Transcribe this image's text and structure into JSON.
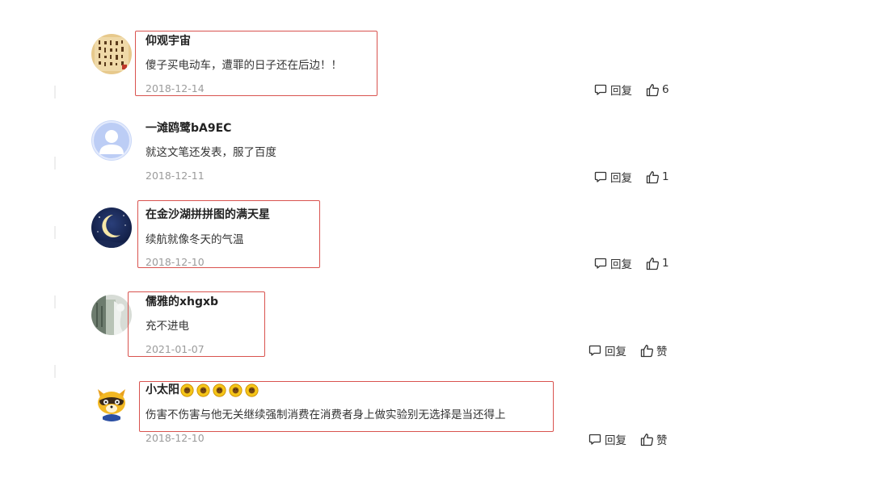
{
  "comments": [
    {
      "username": "仰观宇宙",
      "content": "傻子买电动车，遭罪的日子还在后边！！",
      "date": "2018-12-14",
      "reply_label": "回复",
      "like_label": "6",
      "avatar": "calligraphy-avatar"
    },
    {
      "username": "一滩鸥鹭bA9EC",
      "content": "就这文笔还发表，服了百度",
      "date": "2018-12-11",
      "reply_label": "回复",
      "like_label": "1",
      "avatar": "default-user-avatar"
    },
    {
      "username": "在金沙湖拼拼图的满天星",
      "content": "续航就像冬天的气温",
      "date": "2018-12-10",
      "reply_label": "回复",
      "like_label": "1",
      "avatar": "moon-night-avatar"
    },
    {
      "username": "儒雅的xhgxb",
      "content": "充不进电",
      "date": "2021-01-07",
      "reply_label": "回复",
      "like_label": "赞",
      "avatar": "winter-scene-avatar"
    },
    {
      "username": "小太阳",
      "username_emoji": [
        "sunflower-icon",
        "sunflower-icon",
        "sunflower-icon",
        "sunflower-icon",
        "sunflower-icon"
      ],
      "content": "伤害不伤害与他无关继续强制消费在消费者身上做实验别无选择是当还得上",
      "date": "2018-12-10",
      "reply_label": "回复",
      "like_label": "赞",
      "avatar": "raccoon-cartoon-avatar"
    }
  ],
  "colors": {
    "highlight_border": "#d9534f",
    "username": "#222222",
    "content": "#333333",
    "date": "#9b9b9b"
  }
}
